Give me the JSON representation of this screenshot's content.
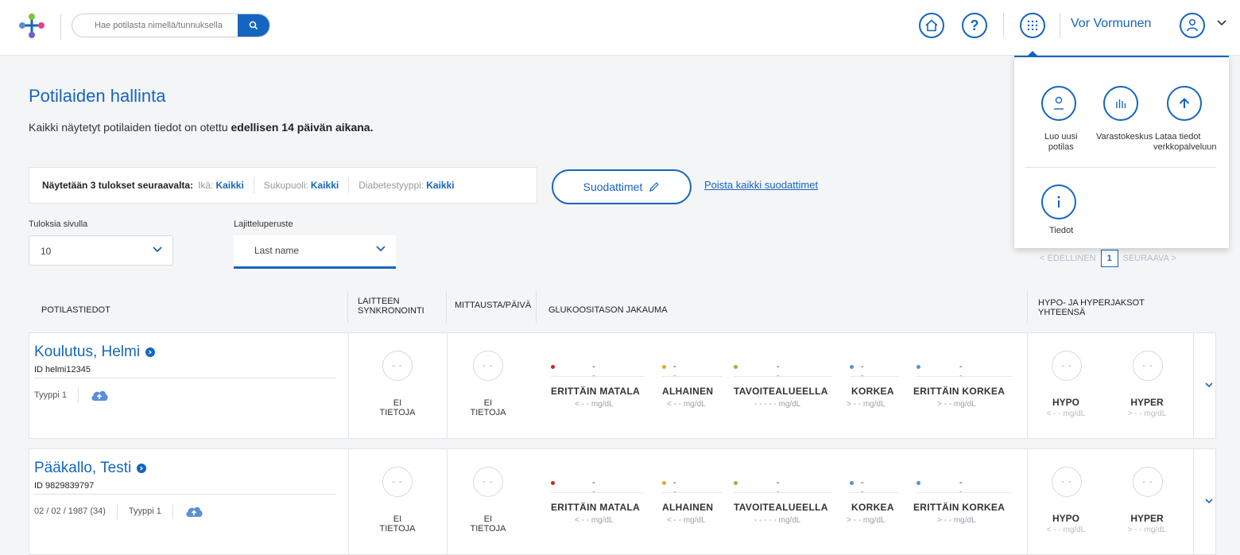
{
  "header": {
    "search_placeholder": "Hae potilasta nimellä/tunnuksella",
    "user_name": "Vor Vormunen"
  },
  "page": {
    "title": "Potilaiden hallinta",
    "subtitle_prefix": "Kaikki näytetyt potilaiden tiedot on otettu ",
    "subtitle_bold": "edellisen 14 päivän aikana."
  },
  "filters": {
    "lead": "Näytetään 3 tulokset seuraavalta:",
    "age_label": "Ikä:",
    "age_value": "Kaikki",
    "gender_label": "Sukupuoli:",
    "gender_value": "Kaikki",
    "diabetes_label": "Diabetestyyppi:",
    "diabetes_value": "Kaikki",
    "filters_button": "Suodattimet",
    "clear_all": "Poista kaikki suodattimet"
  },
  "controls": {
    "per_page_label": "Tuloksia sivulla",
    "per_page_value": "10",
    "sort_label": "Lajitteluperuste",
    "sort_value": "Last name"
  },
  "pager": {
    "prev": "EDELLINEN",
    "page": "1",
    "next": "SEURAAVA"
  },
  "table": {
    "headers": {
      "patient": "POTILASTIEDOT",
      "device_sync_1": "LAITTEEN",
      "device_sync_2": "SYNKRONOINTI",
      "measurements": "MITTAUSTA/PÄIVÄ",
      "glucose": "GLUKOOSITASON JAKAUMA",
      "hypo_hyper_1": "HYPO- JA HYPERJAKSOT",
      "hypo_hyper_2": "YHTEENSÄ"
    },
    "placeholder_circle": "- -",
    "no_data_1": "EI",
    "no_data_2": "TIETOJA",
    "glucose_ranges": [
      {
        "label": "ERITTÄIN MATALA",
        "value": "- -",
        "unit": "< - -  mg/dL",
        "color": "#c62828"
      },
      {
        "label": "ALHAINEN",
        "value": "- -",
        "unit": "< - -  mg/dL",
        "color": "#f0a030"
      },
      {
        "label": "TAVOITEALUEELLA",
        "value": "- -",
        "unit": "- - - - -  mg/dL",
        "color": "#7cc242"
      },
      {
        "label": "KORKEA",
        "value": "- -",
        "unit": "> - -  mg/dL",
        "color": "#5b8fd6"
      },
      {
        "label": "ERITTÄIN KORKEA",
        "value": "- -",
        "unit": "> - -  mg/dL",
        "color": "#5b8fd6"
      }
    ],
    "hypo_label": "HYPO",
    "hypo_unit": "< - -  mg/dL",
    "hyper_label": "HYPER",
    "hyper_unit": "> - -  mg/dL"
  },
  "patients": [
    {
      "name": "Koulutus, Helmi",
      "id": "ID helmi12345",
      "dob": "",
      "type": "Tyyppi 1"
    },
    {
      "name": "Pääkallo, Testi",
      "id": "ID 9829839797",
      "dob": "02 / 02 / 1987 (34)",
      "type": "Tyyppi 1"
    }
  ],
  "menu": {
    "create_patient_1": "Luo uusi",
    "create_patient_2": "potilas",
    "warehouse": "Varastokeskus",
    "upload_1": "Lataa tiedot",
    "upload_2": "verkkopalveluun",
    "info": "Tiedot"
  },
  "colors": {
    "accent": "#1565c0"
  }
}
